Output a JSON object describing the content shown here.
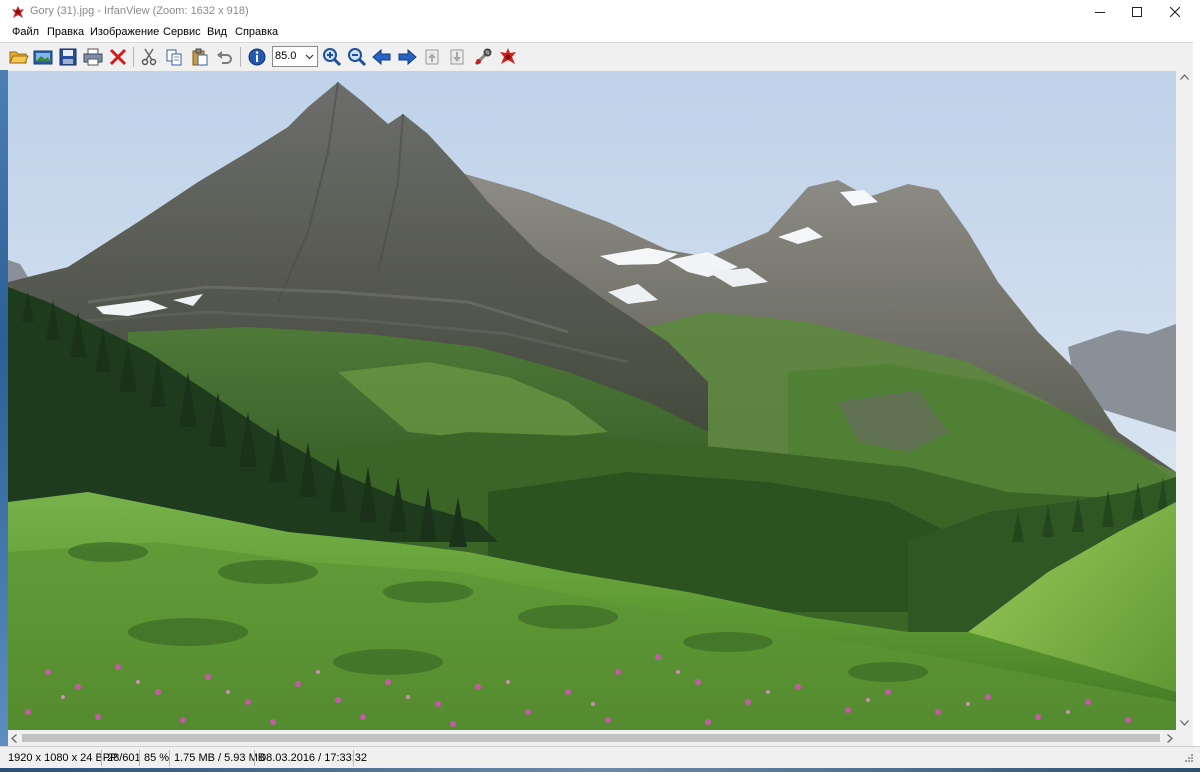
{
  "window": {
    "title": "Gory (31).jpg - IrfanView (Zoom: 1632 x 918)",
    "minimize_icon": "minimize-icon",
    "maximize_icon": "maximize-icon",
    "close_icon": "close-icon"
  },
  "menu": {
    "items": [
      "Файл",
      "Правка",
      "Изображение",
      "Сервис",
      "Вид",
      "Справка"
    ]
  },
  "toolbar": {
    "icons": [
      "open-folder-icon",
      "slideshow-icon",
      "save-icon",
      "print-icon",
      "delete-icon",
      "cut-icon",
      "copy-icon",
      "paste-icon",
      "undo-icon",
      "info-icon",
      "zoom-in-icon",
      "zoom-out-icon",
      "previous-icon",
      "next-icon",
      "first-page-icon",
      "last-page-icon",
      "settings-icon",
      "irfanview-icon"
    ],
    "zoom_value": "85.0"
  },
  "statusbar": {
    "dimensions": "1920 x 1080 x 24 BPP",
    "position": "28/601",
    "zoom": "85 %",
    "size": "1.75 MB / 5.93 MB",
    "datetime": "08.03.2016 / 17:33:32"
  },
  "image": {
    "subject": "mountain-landscape-photo"
  }
}
